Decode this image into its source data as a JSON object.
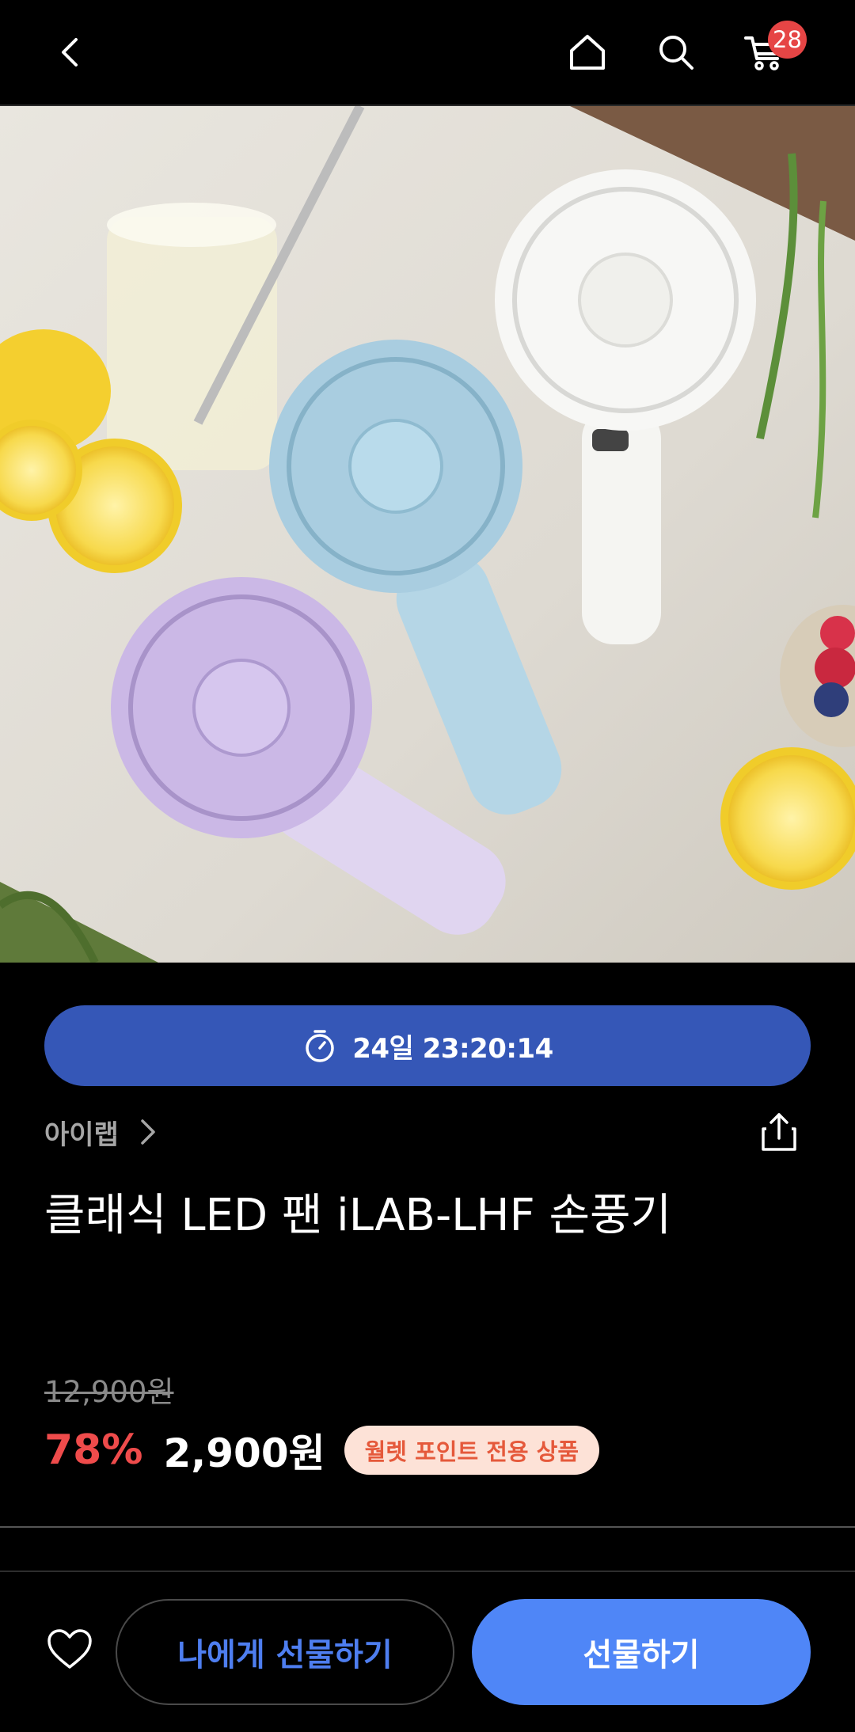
{
  "topbar": {
    "back_icon": "chevron-left-icon",
    "home_icon": "home-icon",
    "search_icon": "search-icon",
    "cart_icon": "cart-icon",
    "cart_count": "28"
  },
  "timer": {
    "icon": "stopwatch-icon",
    "text": "24일 23:20:14"
  },
  "product": {
    "brand": "아이랩",
    "title": "클래식 LED 팬 iLAB-LHF 손풍기",
    "original_price": "12,900원",
    "discount": "78%",
    "price": "2,900원",
    "badge": "월렛 포인트 전용 상품"
  },
  "actions": {
    "gift_to_me": "나에게 선물하기",
    "gift": "선물하기"
  },
  "colors": {
    "timer_bg": "#3557b7",
    "discount": "#ef4b4b",
    "badge_bg": "#fde2d7",
    "badge_text": "#e5593b",
    "primary_button": "#4f86f7",
    "secondary_button_text": "#4e7ef0",
    "cart_badge": "#e64545"
  }
}
